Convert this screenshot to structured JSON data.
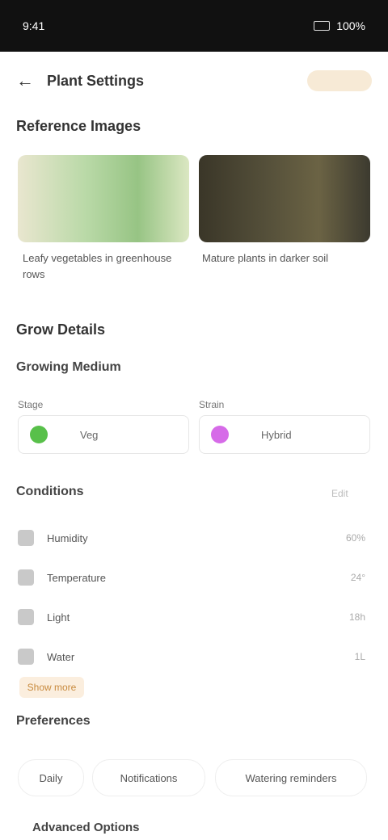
{
  "status_bar": {
    "time": "9:41",
    "battery": "100%"
  },
  "top_bar": {
    "title": "Plant Settings"
  },
  "sections": {
    "reference_images": "Reference Images",
    "grow_details": "Grow Details",
    "growing_medium": "Growing Medium",
    "conditions": "Conditions",
    "preferences": "Preferences"
  },
  "images": [
    {
      "caption": "Leafy vegetables in greenhouse rows"
    },
    {
      "caption": "Mature plants in darker soil"
    }
  ],
  "fields": {
    "stage_label": "Stage",
    "stage_value": "Veg",
    "stage_color": "#58c04a",
    "strain_label": "Strain",
    "strain_value": "Hybrid",
    "strain_color": "#d66be8"
  },
  "conditions": [
    {
      "label": "Humidity",
      "value": "60%"
    },
    {
      "label": "Temperature",
      "value": "24°"
    },
    {
      "label": "Light",
      "value": "18h"
    },
    {
      "label": "Water",
      "value": "1L"
    }
  ],
  "conditions_action": "Edit",
  "show_more": "Show more",
  "chips": [
    "Daily",
    "Notifications",
    "Watering reminders"
  ],
  "bottom_section": "Advanced Options"
}
